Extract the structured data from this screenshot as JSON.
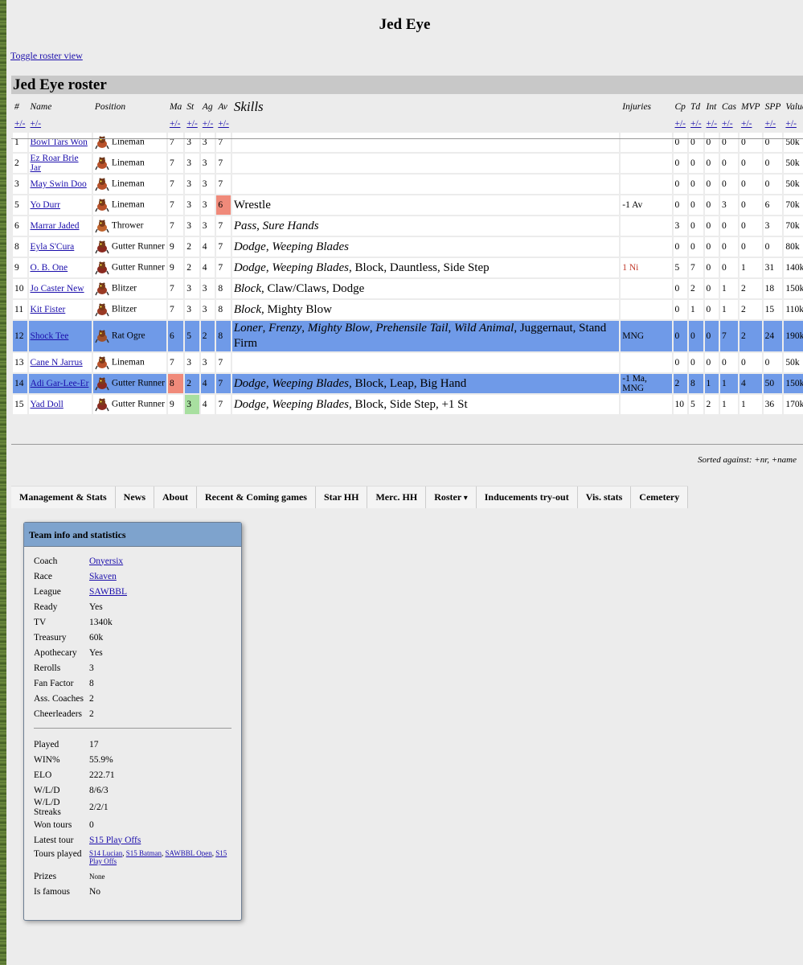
{
  "title": "Jed Eye",
  "toggle_link": "Toggle roster view",
  "roster_title": "Jed Eye roster",
  "columns": [
    "#",
    "Name",
    "Position",
    "Ma",
    "St",
    "Ag",
    "Av",
    "Skills",
    "Injuries",
    "Cp",
    "Td",
    "Int",
    "Cas",
    "MVP",
    "SPP",
    "Value"
  ],
  "sort_toggle": "+/-",
  "players": [
    {
      "num": "1",
      "name": "Bowl Tars Won",
      "position": "Lineman",
      "icon": "skaven-lineman-icon",
      "ma": "7",
      "st": "3",
      "ag": "3",
      "av": "7",
      "skills": [],
      "injuries": "",
      "cp": "0",
      "td": "0",
      "int": "0",
      "cas": "0",
      "mvp": "0",
      "spp": "0",
      "value": "50k"
    },
    {
      "num": "2",
      "name": "Ez Roar Brie Jar",
      "position": "Lineman",
      "icon": "skaven-lineman-icon",
      "ma": "7",
      "st": "3",
      "ag": "3",
      "av": "7",
      "skills": [],
      "injuries": "",
      "cp": "0",
      "td": "0",
      "int": "0",
      "cas": "0",
      "mvp": "0",
      "spp": "0",
      "value": "50k"
    },
    {
      "num": "3",
      "name": "May Swin Doo",
      "position": "Lineman",
      "icon": "skaven-lineman-icon",
      "ma": "7",
      "st": "3",
      "ag": "3",
      "av": "7",
      "skills": [],
      "injuries": "",
      "cp": "0",
      "td": "0",
      "int": "0",
      "cas": "0",
      "mvp": "0",
      "spp": "0",
      "value": "50k"
    },
    {
      "num": "5",
      "name": "Yo Durr",
      "position": "Lineman",
      "icon": "skaven-lineman-icon",
      "ma": "7",
      "st": "3",
      "ag": "3",
      "av": "6",
      "av_state": "bad",
      "skills": [
        {
          "t": "Wrestle",
          "i": false
        }
      ],
      "injuries": "-1 Av",
      "cp": "0",
      "td": "0",
      "int": "0",
      "cas": "3",
      "mvp": "0",
      "spp": "6",
      "value": "70k"
    },
    {
      "num": "6",
      "name": "Marrar Jaded",
      "position": "Thrower",
      "icon": "skaven-thrower-icon",
      "ma": "7",
      "st": "3",
      "ag": "3",
      "av": "7",
      "skills": [
        {
          "t": "Pass",
          "i": true
        },
        {
          "t": "Sure Hands",
          "i": true
        }
      ],
      "injuries": "",
      "cp": "3",
      "td": "0",
      "int": "0",
      "cas": "0",
      "mvp": "0",
      "spp": "3",
      "value": "70k"
    },
    {
      "num": "8",
      "name": "Eyla S'Cura",
      "position": "Gutter Runner",
      "icon": "gutter-runner-icon",
      "ma": "9",
      "st": "2",
      "ag": "4",
      "av": "7",
      "skills": [
        {
          "t": "Dodge",
          "i": true
        },
        {
          "t": "Weeping Blades",
          "i": true
        }
      ],
      "injuries": "",
      "cp": "0",
      "td": "0",
      "int": "0",
      "cas": "0",
      "mvp": "0",
      "spp": "0",
      "value": "80k"
    },
    {
      "num": "9",
      "name": "O. B. One",
      "position": "Gutter Runner",
      "icon": "gutter-runner-icon",
      "ma": "9",
      "st": "2",
      "ag": "4",
      "av": "7",
      "skills": [
        {
          "t": "Dodge",
          "i": true
        },
        {
          "t": "Weeping Blades",
          "i": true
        },
        {
          "t": "Block",
          "i": false
        },
        {
          "t": "Dauntless",
          "i": false
        },
        {
          "t": "Side Step",
          "i": false
        }
      ],
      "injuries": "1 Ni",
      "injuries_red": true,
      "cp": "5",
      "td": "7",
      "int": "0",
      "cas": "0",
      "mvp": "1",
      "spp": "31",
      "value": "140k"
    },
    {
      "num": "10",
      "name": "Jo Caster New",
      "position": "Blitzer",
      "icon": "skaven-blitzer-icon",
      "ma": "7",
      "st": "3",
      "ag": "3",
      "av": "8",
      "skills": [
        {
          "t": "Block",
          "i": true
        },
        {
          "t": "Claw/Claws",
          "i": false
        },
        {
          "t": "Dodge",
          "i": false
        }
      ],
      "injuries": "",
      "cp": "0",
      "td": "2",
      "int": "0",
      "cas": "1",
      "mvp": "2",
      "spp": "18",
      "value": "150k"
    },
    {
      "num": "11",
      "name": "Kit Fister",
      "position": "Blitzer",
      "icon": "skaven-blitzer-icon",
      "ma": "7",
      "st": "3",
      "ag": "3",
      "av": "8",
      "skills": [
        {
          "t": "Block",
          "i": true
        },
        {
          "t": "Mighty Blow",
          "i": false
        }
      ],
      "injuries": "",
      "cp": "0",
      "td": "1",
      "int": "0",
      "cas": "1",
      "mvp": "2",
      "spp": "15",
      "value": "110k"
    },
    {
      "num": "12",
      "name": "Shock Tee",
      "position": "Rat Ogre",
      "icon": "rat-ogre-icon",
      "ma": "6",
      "st": "5",
      "ag": "2",
      "av": "8",
      "highlight": true,
      "skills": [
        {
          "t": "Loner",
          "i": true
        },
        {
          "t": "Frenzy",
          "i": true
        },
        {
          "t": "Mighty Blow",
          "i": true
        },
        {
          "t": "Prehensile Tail",
          "i": true
        },
        {
          "t": "Wild Animal",
          "i": true
        },
        {
          "t": "Juggernaut",
          "i": false
        },
        {
          "t": "Stand Firm",
          "i": false
        }
      ],
      "injuries": "MNG",
      "cp": "0",
      "td": "0",
      "int": "0",
      "cas": "7",
      "mvp": "2",
      "spp": "24",
      "value": "190k"
    },
    {
      "num": "13",
      "name": "Cane N Jarrus",
      "position": "Lineman",
      "icon": "skaven-lineman-icon",
      "ma": "7",
      "st": "3",
      "ag": "3",
      "av": "7",
      "skills": [],
      "injuries": "",
      "cp": "0",
      "td": "0",
      "int": "0",
      "cas": "0",
      "mvp": "0",
      "spp": "0",
      "value": "50k"
    },
    {
      "num": "14",
      "name": "Adi Gar-Lee-Er",
      "position": "Gutter Runner",
      "icon": "gutter-runner-icon",
      "ma": "8",
      "ma_state": "bad",
      "st": "2",
      "ag": "4",
      "av": "7",
      "highlight": true,
      "skills": [
        {
          "t": "Dodge",
          "i": true
        },
        {
          "t": "Weeping Blades",
          "i": true
        },
        {
          "t": "Block",
          "i": false
        },
        {
          "t": "Leap",
          "i": false
        },
        {
          "t": "Big Hand",
          "i": false
        }
      ],
      "injuries": "-1 Ma, MNG",
      "cp": "2",
      "td": "8",
      "int": "1",
      "cas": "1",
      "mvp": "4",
      "spp": "50",
      "value": "150k"
    },
    {
      "num": "15",
      "name": "Yad Doll",
      "position": "Gutter Runner",
      "icon": "gutter-runner-icon",
      "ma": "9",
      "st": "3",
      "st_state": "good",
      "ag": "4",
      "av": "7",
      "skills": [
        {
          "t": "Dodge",
          "i": true
        },
        {
          "t": "Weeping Blades",
          "i": true
        },
        {
          "t": "Block",
          "i": false
        },
        {
          "t": "Side Step",
          "i": false
        },
        {
          "t": "+1 St",
          "i": false
        }
      ],
      "injuries": "",
      "cp": "10",
      "td": "5",
      "int": "2",
      "cas": "1",
      "mvp": "1",
      "spp": "36",
      "value": "170k"
    }
  ],
  "sorted_note": "Sorted against: +nr, +name",
  "tabs": [
    "Management & Stats",
    "News",
    "About",
    "Recent & Coming games",
    "Star HH",
    "Merc. HH",
    "Roster",
    "Inducements try-out",
    "Vis. stats",
    "Cemetery"
  ],
  "team_info": {
    "heading": "Team info and statistics",
    "fields1": [
      {
        "k": "Coach",
        "v": "Onyersix",
        "link": true
      },
      {
        "k": "Race",
        "v": "Skaven",
        "link": true
      },
      {
        "k": "League",
        "v": "SAWBBL",
        "link": true
      },
      {
        "k": "Ready",
        "v": "Yes"
      },
      {
        "k": "TV",
        "v": "1340k"
      },
      {
        "k": "Treasury",
        "v": "60k"
      },
      {
        "k": "Apothecary",
        "v": "Yes"
      },
      {
        "k": "Rerolls",
        "v": "3"
      },
      {
        "k": "Fan Factor",
        "v": "8"
      },
      {
        "k": "Ass. Coaches",
        "v": "2"
      },
      {
        "k": "Cheerleaders",
        "v": "2"
      }
    ],
    "fields2": [
      {
        "k": "Played",
        "v": "17"
      },
      {
        "k": "WIN%",
        "v": "55.9%"
      },
      {
        "k": "ELO",
        "v": "222.71"
      },
      {
        "k": "W/L/D",
        "v": "8/6/3"
      },
      {
        "k": "W/L/D Streaks",
        "v": "2/2/1"
      },
      {
        "k": "Won tours",
        "v": "0"
      },
      {
        "k": "Latest tour",
        "v": "S15 Play Offs",
        "link": true
      }
    ],
    "tours_played_label": "Tours played",
    "tours_played": [
      "S14 Lucian",
      "S15 Batman",
      "SAWBBL Open",
      "S15 Play Offs"
    ],
    "prizes_label": "Prizes",
    "prizes": "None",
    "famous_label": "Is famous",
    "famous": "No"
  },
  "colors": {
    "highlight": "#6f9ae8",
    "bad": "#f08a7a",
    "good": "#a8dfa0",
    "panel_header": "#7ea3cd"
  }
}
